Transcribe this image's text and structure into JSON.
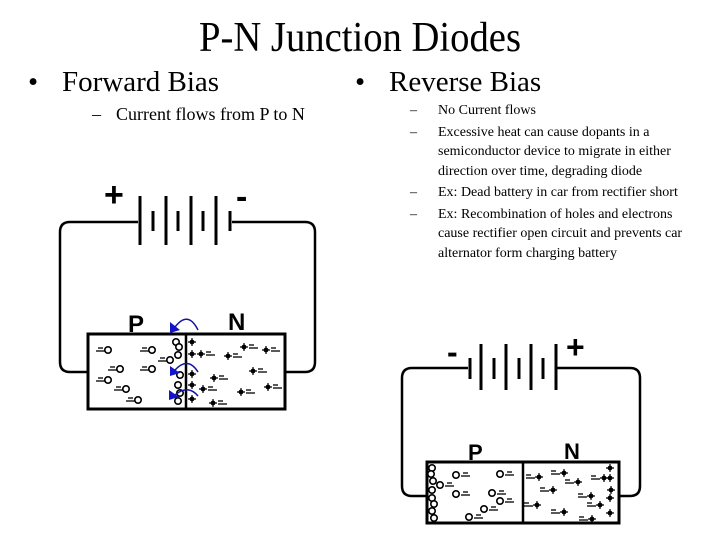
{
  "slide": {
    "title": "P-N Junction Diodes",
    "bullet_glyph": "•",
    "dash_glyph": "–",
    "forward": {
      "heading": "Forward Bias",
      "points": [
        "Current flows from P to N"
      ],
      "diagram": {
        "battery_left_sign": "+",
        "battery_right_sign": "-",
        "p_label": "P",
        "n_label": "N",
        "hole_glyph": "o",
        "electron_glyph": "•",
        "arrow_color": "#1414c8"
      }
    },
    "reverse": {
      "heading": "Reverse Bias",
      "points": [
        "No Current flows",
        "Excessive heat can cause dopants in a semiconductor device to migrate in either direction over time, degrading diode",
        "Ex: Dead battery in car from rectifier short",
        "Ex: Recombination of holes and electrons cause rectifier open circuit and prevents car alternator form charging battery"
      ],
      "diagram": {
        "battery_left_sign": "-",
        "battery_right_sign": "+",
        "p_label": "P",
        "n_label": "N"
      }
    }
  }
}
